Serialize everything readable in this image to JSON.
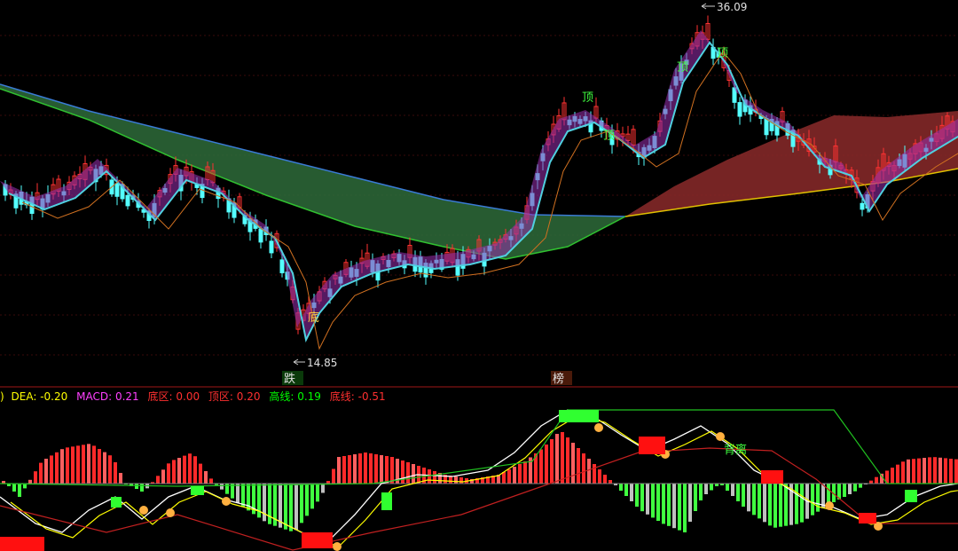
{
  "chart_data": [
    {
      "type": "candlestick",
      "panel": "price",
      "title": "",
      "annotations": {
        "high_label": "36.09",
        "low_label": "14.85",
        "top_marks": [
          "顶",
          "顶",
          "顶",
          "顶"
        ],
        "bottom_mark": "底",
        "bottom_tags": [
          "跌",
          "榜"
        ]
      },
      "y_range": [
        12,
        38
      ],
      "colors": {
        "up": "#ff3232",
        "down": "#54ffff",
        "band_upper": "#2e6b3a",
        "band_lower": "#8b2a2a"
      }
    },
    {
      "type": "bar",
      "panel": "macd",
      "legend": [
        {
          "label": "DEA:",
          "value": "-0.20",
          "color": "#ffff00"
        },
        {
          "label": "MACD:",
          "value": "0.21",
          "color": "#ff40ff"
        },
        {
          "label": "底区:",
          "value": "0.00",
          "color": "#ff3030"
        },
        {
          "label": "顶区:",
          "value": "0.20",
          "color": "#ff3030"
        },
        {
          "label": "高线:",
          "value": "0.19",
          "color": "#00ff00"
        },
        {
          "label": "底线:",
          "value": "-0.51",
          "color": "#ff3030"
        }
      ],
      "legend_prefix": ")",
      "annotation": "背离",
      "colors": {
        "positive": "#ff2a2a",
        "negative": "#40ff40",
        "neutral": "#c0c0c0"
      }
    }
  ]
}
